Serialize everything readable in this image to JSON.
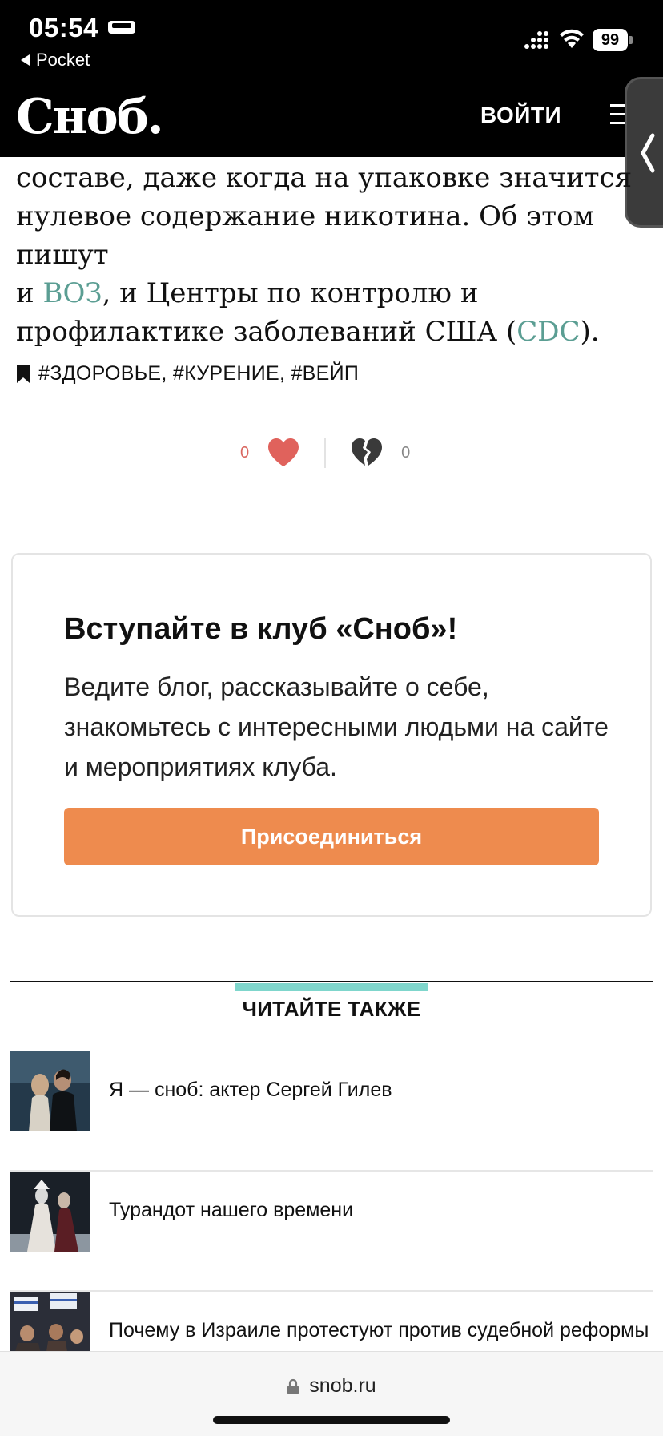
{
  "status_bar": {
    "time": "05:54",
    "back_app": "Pocket",
    "battery": "99",
    "icons": [
      "bed-icon",
      "signal-icon",
      "wifi-icon",
      "battery-icon"
    ]
  },
  "header": {
    "logo": "Сноб.",
    "login_label": "ВОЙТИ",
    "menu_icon": "menu-icon",
    "side_tab_icon": "chevron-left-icon"
  },
  "article": {
    "line1": "составе, даже когда на упаковке значится",
    "line2": "нулевое содержание никотина. Об этом пишут",
    "line3_pre": "и ",
    "line3_link": "ВОЗ",
    "line3_post": ", и Центры по контролю и",
    "line4_pre": "профилактике заболеваний США (",
    "line4_link": "CDC",
    "line4_post": ")."
  },
  "tags": {
    "text": "#ЗДОРОВЬЕ, #КУРЕНИЕ, #ВЕЙП"
  },
  "reactions": {
    "likes": "0",
    "dislikes": "0",
    "like_color": "#e0625c"
  },
  "club": {
    "title": "Вступайте в клуб «Сноб»!",
    "description": "Ведите блог, рассказывайте о себе, знакомьтесь с интересными людьми на сайте и мероприятиях клуба.",
    "button_label": "Присоединиться",
    "button_color": "#ee8b4e"
  },
  "read_also": {
    "title": "ЧИТАЙТЕ ТАКЖЕ",
    "accent_color": "#7fd6cc",
    "items": [
      {
        "title": "Я — сноб: актер Сергей Гилев"
      },
      {
        "title": "Турандот нашего времени"
      },
      {
        "title": "Почему в Израиле протестуют против судебной реформы"
      }
    ]
  },
  "browser": {
    "url": "snob.ru"
  }
}
